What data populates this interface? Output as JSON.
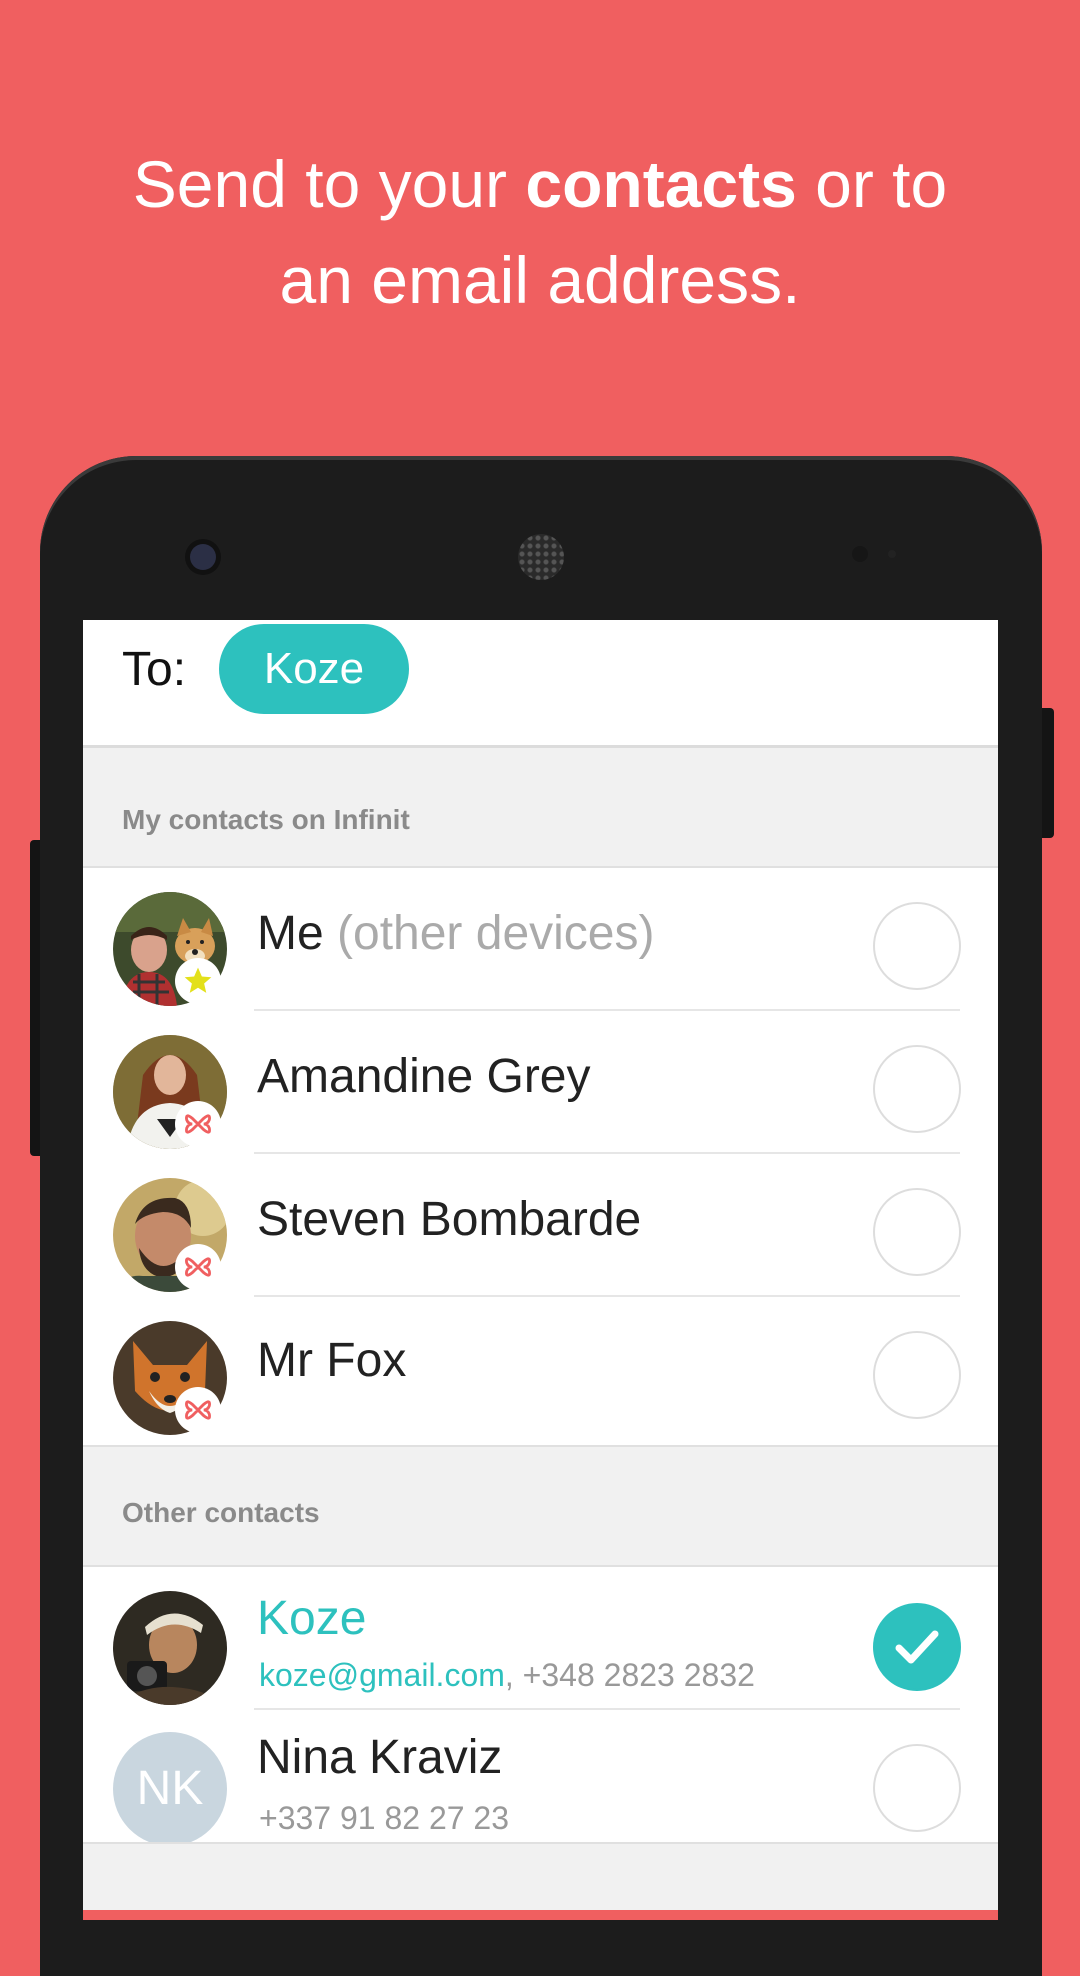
{
  "headline": {
    "part1": "Send to your ",
    "bold": "contacts",
    "part2": " or to",
    "line2": "an email address."
  },
  "to_field": {
    "label": "To:",
    "chip": "Koze"
  },
  "sections": {
    "infinit": "My contacts on Infinit",
    "other": "Other contacts"
  },
  "infinit_contacts": [
    {
      "name": "Me",
      "suffix": " (other devices)",
      "badge": "star-icon",
      "selected": false
    },
    {
      "name": "Amandine Grey",
      "badge": "infinit-icon",
      "selected": false
    },
    {
      "name": "Steven Bombarde",
      "badge": "infinit-icon",
      "selected": false
    },
    {
      "name": "Mr Fox",
      "badge": "infinit-icon",
      "selected": false
    }
  ],
  "other_contacts": [
    {
      "name": "Koze",
      "email": "koze@gmail.com",
      "sep": ", ",
      "phone": "+348 2823 2832",
      "selected": true
    },
    {
      "name": "Nina Kraviz",
      "initials": "NK",
      "phone": "+337 91 82 27 23",
      "selected": false
    }
  ],
  "colors": {
    "background": "#F05F60",
    "accent": "#2DC1BE"
  }
}
